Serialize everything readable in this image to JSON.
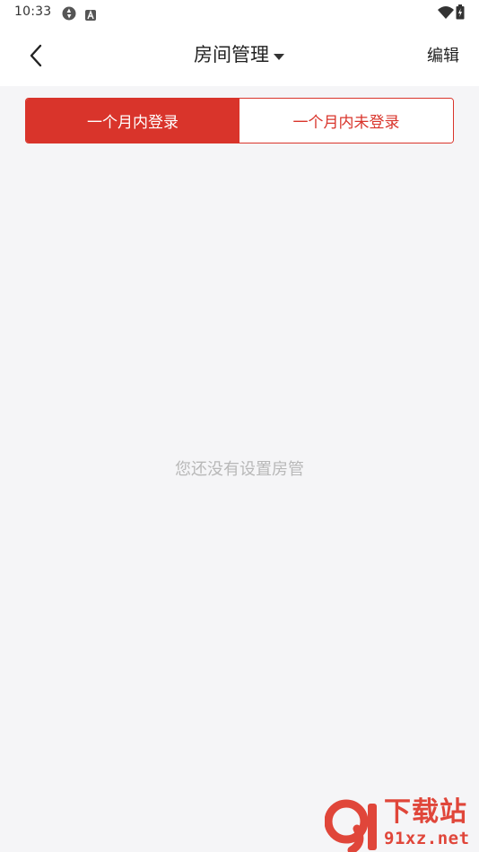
{
  "status_bar": {
    "time": "10:33",
    "icons": [
      "sync-icon",
      "a-badge-icon",
      "wifi-icon",
      "battery-icon"
    ]
  },
  "header": {
    "title": "房间管理",
    "edit_label": "编辑"
  },
  "tabs": [
    {
      "label": "一个月内登录",
      "active": true
    },
    {
      "label": "一个月内未登录",
      "active": false
    }
  ],
  "empty_state": {
    "message": "您还没有设置房管"
  },
  "watermark": {
    "title": "下载站",
    "url": "91xz.net"
  },
  "colors": {
    "accent": "#d9342b",
    "background": "#f5f5f7",
    "empty_text": "#b8b8b8",
    "watermark": "#e0463a"
  }
}
